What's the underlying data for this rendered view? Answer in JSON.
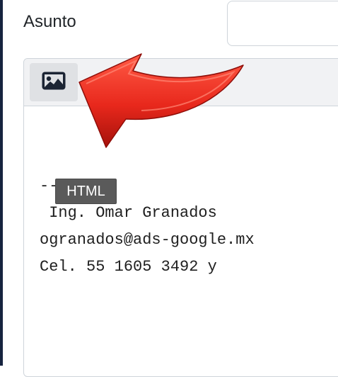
{
  "form": {
    "subject_label": "Asunto",
    "subject_value": "",
    "subject_placeholder": ""
  },
  "editor": {
    "toolbar": {
      "image_button_icon": "image-icon"
    },
    "signature_lines": [
      "--",
      " Ing. Omar Granados",
      "ogranados@ads-google.mx",
      "Cel. 55 1605 3492 y"
    ]
  },
  "tooltip": {
    "text": "HTML"
  },
  "colors": {
    "accent_arrow": "#e8281c",
    "tooltip_bg": "#5a5a5a",
    "toolbar_bg": "#f1f2f4",
    "left_strip": "#16233f"
  }
}
